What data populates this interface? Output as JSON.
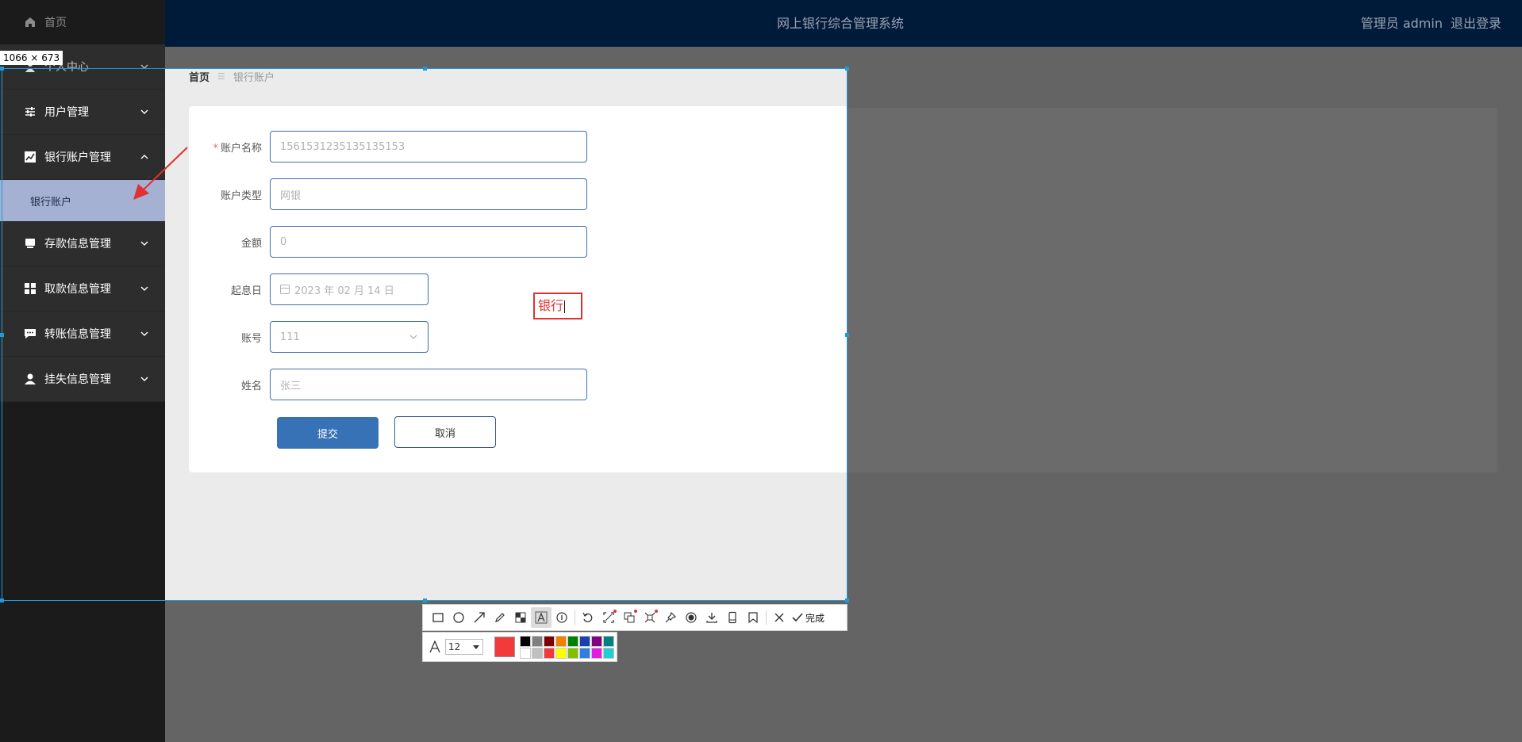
{
  "header": {
    "title": "网上银行综合管理系统",
    "user": "管理员 admin",
    "logout": "退出登录"
  },
  "sidebar": {
    "home": "首页",
    "items": [
      {
        "label": "个人中心",
        "icon": "user-icon"
      },
      {
        "label": "用户管理",
        "icon": "sliders-icon"
      },
      {
        "label": "银行账户管理",
        "icon": "chart-icon",
        "expanded": true,
        "children": [
          "银行账户"
        ]
      },
      {
        "label": "存款信息管理",
        "icon": "tray-icon"
      },
      {
        "label": "取款信息管理",
        "icon": "grid-icon"
      },
      {
        "label": "转账信息管理",
        "icon": "chat-icon"
      },
      {
        "label": "挂失信息管理",
        "icon": "person-icon"
      }
    ]
  },
  "breadcrumb": {
    "home": "首页",
    "separator": "☰",
    "current": "银行账户"
  },
  "form": {
    "account_name": {
      "label": "账户名称",
      "value": "1561531235135135153",
      "required": true
    },
    "account_type": {
      "label": "账户类型",
      "value": "网银"
    },
    "amount": {
      "label": "金额",
      "value": "0"
    },
    "start_date": {
      "label": "起息日",
      "value": "2023 年 02 月 14 日"
    },
    "account_no": {
      "label": "账号",
      "value": "111"
    },
    "name": {
      "label": "姓名",
      "value": "张三"
    },
    "submit": "提交",
    "cancel": "取消"
  },
  "screenshot_tool": {
    "size_label": "1066 × 673",
    "annotation_text": "银行",
    "done_label": "完成",
    "font_size": "12",
    "current_color": "#f23a3a",
    "palette": [
      "#000000",
      "#808080",
      "#800000",
      "#f08000",
      "#008000",
      "#1c3fb0",
      "#800080",
      "#008080",
      "#ffffff",
      "#c0c0c0",
      "#f23a3a",
      "#ffff00",
      "#80c000",
      "#2f7fe0",
      "#e020e0",
      "#20d0d0"
    ]
  },
  "colors": {
    "header_bg": "#001a3a",
    "sidebar_bg": "#2d2d2d",
    "active_sub_bg": "#a4b1d3",
    "primary": "#3771b6",
    "selection": "#1e9bd7"
  }
}
